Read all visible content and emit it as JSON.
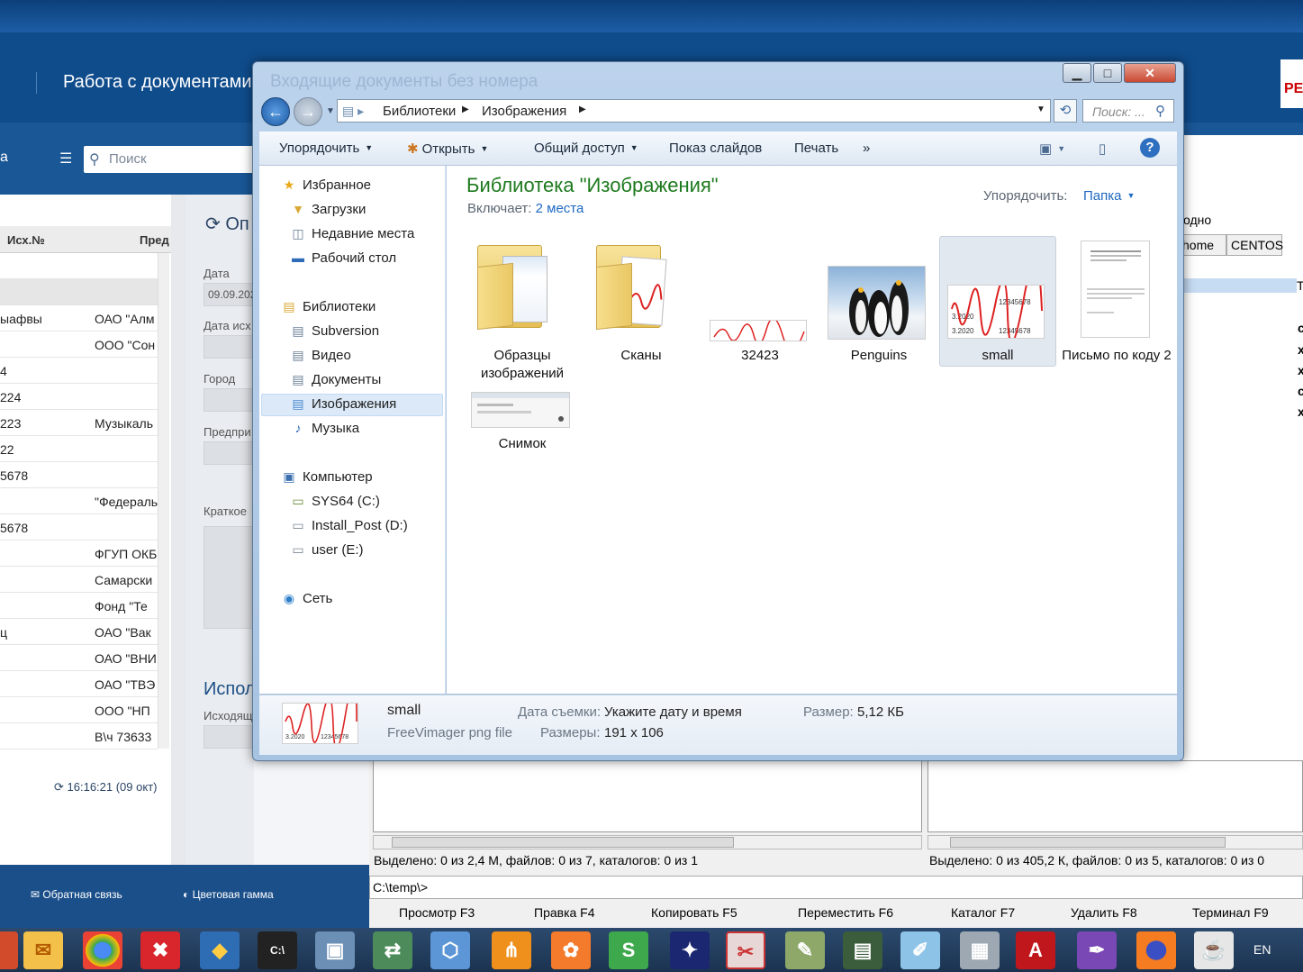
{
  "background_app": {
    "title": "Работа с документами",
    "ghost_title": "Входящие документы без номера",
    "logo_text": "РЕ",
    "toolbar_label": "а",
    "search_placeholder": "Поиск",
    "table_headers": [
      "Исх.№",
      "Пред"
    ],
    "rows": [
      {
        "num": "",
        "org": ""
      },
      {
        "num": "",
        "org": ""
      },
      {
        "num": "ыафвы",
        "org": "ОАО \"Алм"
      },
      {
        "num": "",
        "org": "ООО \"Сон"
      },
      {
        "num": "4",
        "org": ""
      },
      {
        "num": "224",
        "org": ""
      },
      {
        "num": "223",
        "org": "Музыкаль"
      },
      {
        "num": "22",
        "org": ""
      },
      {
        "num": "5678",
        "org": ""
      },
      {
        "num": "",
        "org": "\"Федераль"
      },
      {
        "num": "5678",
        "org": ""
      },
      {
        "num": "",
        "org": "ФГУП ОКБ"
      },
      {
        "num": "",
        "org": "Самарски"
      },
      {
        "num": "",
        "org": "Фонд \"Те"
      },
      {
        "num": "ц",
        "org": "ОАО \"Вак"
      },
      {
        "num": "",
        "org": "ОАО \"ВНИ"
      },
      {
        "num": "",
        "org": "ОАО \"ТВЭ"
      },
      {
        "num": "",
        "org": "ООО \"НП"
      },
      {
        "num": "",
        "org": "В\\ч 73633"
      }
    ],
    "refresh_time": "16:16:21 (09 окт)",
    "form": {
      "section": "Оп",
      "date_label": "Дата",
      "date_value": "09.09.202",
      "outdate_label": "Дата исх",
      "city_label": "Город",
      "company_label": "Предпри",
      "short_label": "Краткое",
      "exec_section": "Испол",
      "outgoing_label": "Исходящ"
    },
    "feedback": "Обратная связь",
    "color_scheme": "Цветовая гамма"
  },
  "total_commander": {
    "right_text": [
      "одно",
      "home",
      "CENTOS",
      "Т"
    ],
    "right_glyphs": [
      "с",
      "х",
      "х",
      "с",
      "х"
    ],
    "left_status": "Выделено: 0 из 2,4 М, файлов: 0 из 7, каталогов: 0 из 1",
    "right_status": "Выделено: 0 из 405,2 К, файлов: 0 из 5, каталогов: 0 из 0",
    "cmd_path": "C:\\temp\\>",
    "fkeys": [
      "Просмотр F3",
      "Правка F4",
      "Копировать F5",
      "Переместить F6",
      "Каталог F7",
      "Удалить F8",
      "Терминал F9"
    ]
  },
  "explorer": {
    "breadcrumb": [
      "Библиотеки",
      "Изображения"
    ],
    "search_placeholder": "Поиск: ...",
    "toolbar": {
      "organize": "Упорядочить",
      "open": "Открыть",
      "share": "Общий доступ",
      "slideshow": "Показ слайдов",
      "print": "Печать",
      "more": "»"
    },
    "nav": {
      "favorites": "Избранное",
      "downloads": "Загрузки",
      "recent": "Недавние места",
      "desktop": "Рабочий стол",
      "libraries": "Библиотеки",
      "subversion": "Subversion",
      "video": "Видео",
      "documents": "Документы",
      "images": "Изображения",
      "music": "Музыка",
      "computer": "Компьютер",
      "drive_c": "SYS64 (C:)",
      "drive_d": "Install_Post (D:)",
      "drive_e": "user (E:)",
      "network": "Сеть"
    },
    "library_title": "Библиотека \"Изображения\"",
    "includes_label": "Включает:",
    "includes_value": "2 места",
    "arrange_label": "Упорядочить:",
    "arrange_value": "Папка",
    "items": {
      "sample_images": "Образцы изображений",
      "scans": "Сканы",
      "img_32423": "32423",
      "penguins": "Penguins",
      "small": "small",
      "letter": "Письмо по коду 2",
      "snapshot": "Снимок"
    },
    "thumb_text": {
      "date": "3.2020",
      "num": "12345678",
      "top": "1.1 111"
    },
    "details": {
      "name": "small",
      "type": "FreeVimager png file",
      "date_label": "Дата съемки:",
      "date_value": "Укажите дату и время",
      "size_label": "Размер:",
      "size_value": "5,12 КБ",
      "dims_label": "Размеры:",
      "dims_value": "191 x 106"
    }
  },
  "taskbar": {
    "lang": "EN"
  },
  "colors": {
    "library_title": "#1e7a1e",
    "link": "#1e6ac2",
    "header_blue": "#0f4c8c"
  }
}
